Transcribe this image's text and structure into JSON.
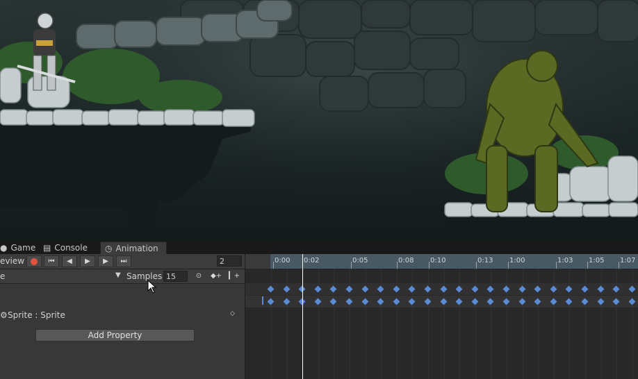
{
  "tabs": [
    {
      "label": "Game",
      "icon": "game-icon"
    },
    {
      "label": "Console",
      "icon": "console-icon"
    },
    {
      "label": "Animation",
      "icon": "clock-icon",
      "active": true
    }
  ],
  "toolbar": {
    "preview_label": "eview",
    "record": "record-icon",
    "frame_value": "2"
  },
  "clip_row": {
    "samples_label": "Samples",
    "samples_value": "15"
  },
  "property": {
    "label": "Sprite : Sprite"
  },
  "add_property_label": "Add Property",
  "timeline": {
    "tick_labels": [
      "0:00",
      "0:02",
      "0:05",
      "0:08",
      "0:10",
      "0:13",
      "1:00",
      "1:03",
      "1:05",
      "1:07"
    ]
  },
  "colors": {
    "record": "#e0533d",
    "keyframe": "#5b8bd5",
    "ruler_range": "#485964"
  }
}
